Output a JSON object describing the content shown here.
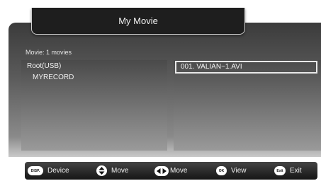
{
  "window": {
    "title": "My Movie"
  },
  "content": {
    "count_label": "Movie: 1 movies",
    "tree": {
      "root": "Root(USB)",
      "child": "MYRECORD"
    },
    "files": [
      "001. VALIAN~1.AVI"
    ]
  },
  "footer": {
    "device": {
      "badge": "DISP.",
      "label": "Device",
      "icon": "disp-button-icon"
    },
    "move_vertical": {
      "label": "Move",
      "icon": "up-down-arrows-icon"
    },
    "move_horizontal": {
      "label": "Move",
      "icon": "left-right-arrows-icon"
    },
    "view": {
      "badge": "OK",
      "label": "View",
      "icon": "ok-button-icon"
    },
    "exit": {
      "badge": "Exit",
      "label": "Exit",
      "icon": "exit-button-icon"
    }
  },
  "colors": {
    "background": "#ffffff",
    "panel_dark": "#4a4a4a",
    "footer": "#151515"
  }
}
